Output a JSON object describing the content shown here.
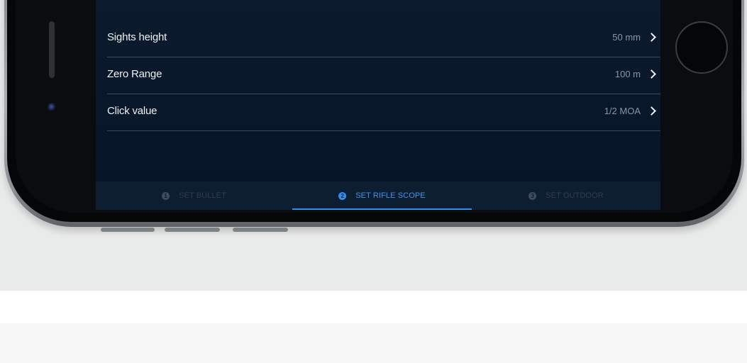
{
  "settings": {
    "rows": [
      {
        "label": "Sights height",
        "value": "50 mm"
      },
      {
        "label": "Zero Range",
        "value": "100 m"
      },
      {
        "label": "Click value",
        "value": "1/2 MOA"
      }
    ]
  },
  "tabs": [
    {
      "step": "1",
      "label": "SET BULLET",
      "state": "inactive"
    },
    {
      "step": "2",
      "label": "SET RIFLE SCOPE",
      "state": "active"
    },
    {
      "step": "3",
      "label": "SET OUTDOOR",
      "state": "inactive"
    }
  ],
  "colors": {
    "screen_bg": "#081729",
    "accent": "#2f8ff0",
    "row_label": "#eef2f6",
    "row_value": "#8896a6",
    "divider": "#3d4a58",
    "page_bg": "#e9eaea"
  },
  "icons": {
    "row_chevron": "chevron-right-icon"
  }
}
